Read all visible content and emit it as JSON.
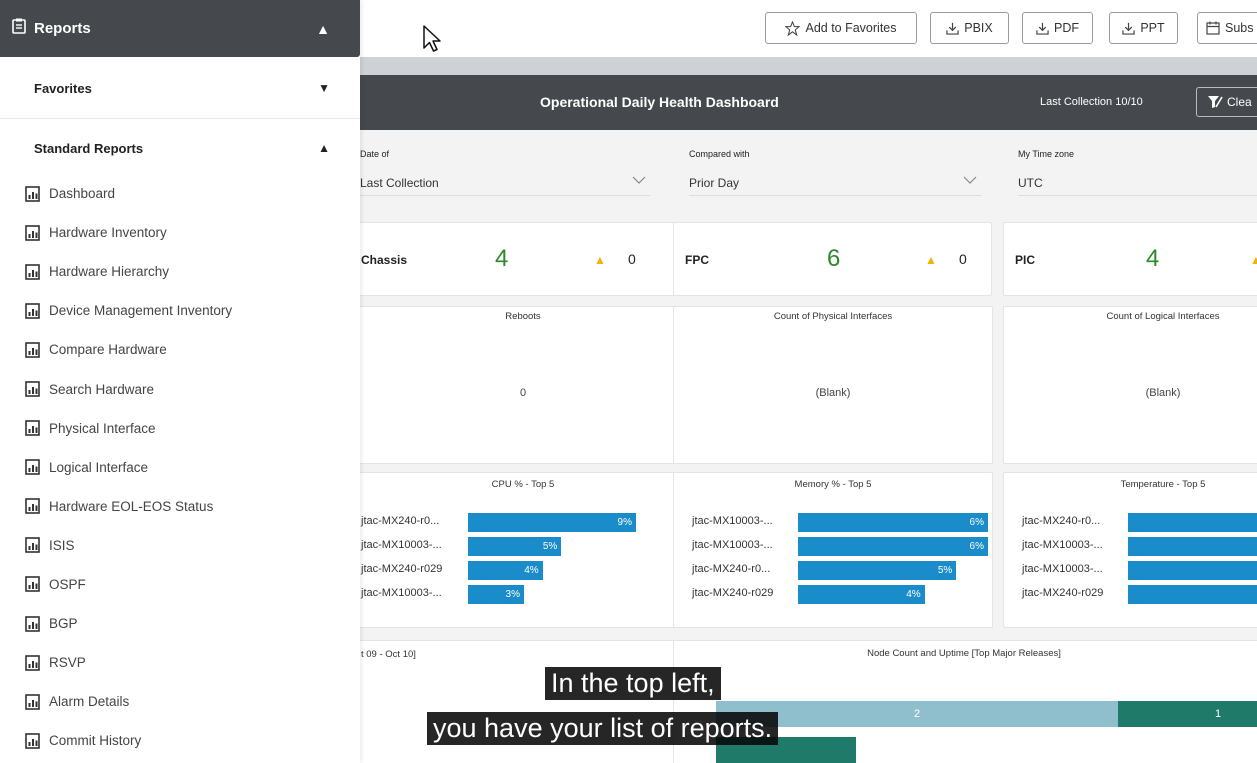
{
  "sidebar": {
    "title": "Reports",
    "favorites_label": "Favorites",
    "standard_label": "Standard Reports",
    "items": [
      "Dashboard",
      "Hardware Inventory",
      "Hardware Hierarchy",
      "Device Management Inventory",
      "Compare Hardware",
      "Search Hardware",
      "Physical Interface",
      "Logical Interface",
      "Hardware EOL-EOS Status",
      "ISIS",
      "OSPF",
      "BGP",
      "RSVP",
      "Alarm Details",
      "Commit History"
    ]
  },
  "toolbar": {
    "favorites": "Add to Favorites",
    "pbix": "PBIX",
    "pdf": "PDF",
    "ppt": "PPT",
    "subscribe": "Subs"
  },
  "dashboard": {
    "title": "Operational Daily Health Dashboard",
    "last_collection": "Last Collection 10/10",
    "clear_label": "Clea",
    "filters": {
      "date_label": "Date of",
      "date_value": "Last Collection",
      "compare_label": "Compared with",
      "compare_value": "Prior Day",
      "tz_label": "My Time zone",
      "tz_value": "UTC"
    },
    "kpis": [
      {
        "name": "Chassis",
        "value": "4",
        "alerts": "0"
      },
      {
        "name": "FPC",
        "value": "6",
        "alerts": "0"
      },
      {
        "name": "PIC",
        "value": "4",
        "alerts": ""
      }
    ],
    "stats": [
      {
        "title": "Reboots",
        "value": "0"
      },
      {
        "title": "Count of Physical Interfaces",
        "value": "(Blank)"
      },
      {
        "title": "Count of Logical Interfaces",
        "value": "(Blank)"
      }
    ],
    "date_range_label": "t 09 - Oct 10]",
    "node_title": "Node Count and Uptime [Top Major Releases]",
    "node_values": [
      "2",
      "1"
    ]
  },
  "chart_data": [
    {
      "type": "bar",
      "title": "CPU % - Top 5",
      "categories": [
        "jtac-MX240-r0...",
        "jtac-MX10003-...",
        "jtac-MX240-r029",
        "jtac-MX10003-..."
      ],
      "values": [
        9,
        5,
        4,
        3
      ],
      "value_labels": [
        "9%",
        "5%",
        "4%",
        "3%"
      ]
    },
    {
      "type": "bar",
      "title": "Memory % - Top 5",
      "categories": [
        "jtac-MX10003-...",
        "jtac-MX10003-...",
        "jtac-MX240-r0...",
        "jtac-MX240-r029"
      ],
      "values": [
        6,
        6,
        5,
        4
      ],
      "value_labels": [
        "6%",
        "6%",
        "5%",
        "4%"
      ]
    },
    {
      "type": "bar",
      "title": "Temperature - Top 5",
      "categories": [
        "jtac-MX240-r0...",
        "jtac-MX10003-...",
        "jtac-MX10003-...",
        "jtac-MX240-r029"
      ],
      "values": [],
      "value_labels": []
    }
  ],
  "caption": {
    "line1": "In the top left,",
    "line2": "you have your list of reports."
  },
  "colors": {
    "header_bg": "#45494d",
    "bar_blue": "#1a8cc9",
    "kpi_green": "#2c8a2c",
    "warn_yellow": "#f2b200",
    "node_light": "#8fbfcc",
    "node_dark": "#1f7a6a"
  },
  "icons": [
    "reports-icon",
    "star-icon",
    "download-icon",
    "calendar-icon",
    "report-doc-icon",
    "cursor-icon",
    "clear-filter-icon",
    "chevron-down-icon",
    "warning-triangle-icon"
  ]
}
